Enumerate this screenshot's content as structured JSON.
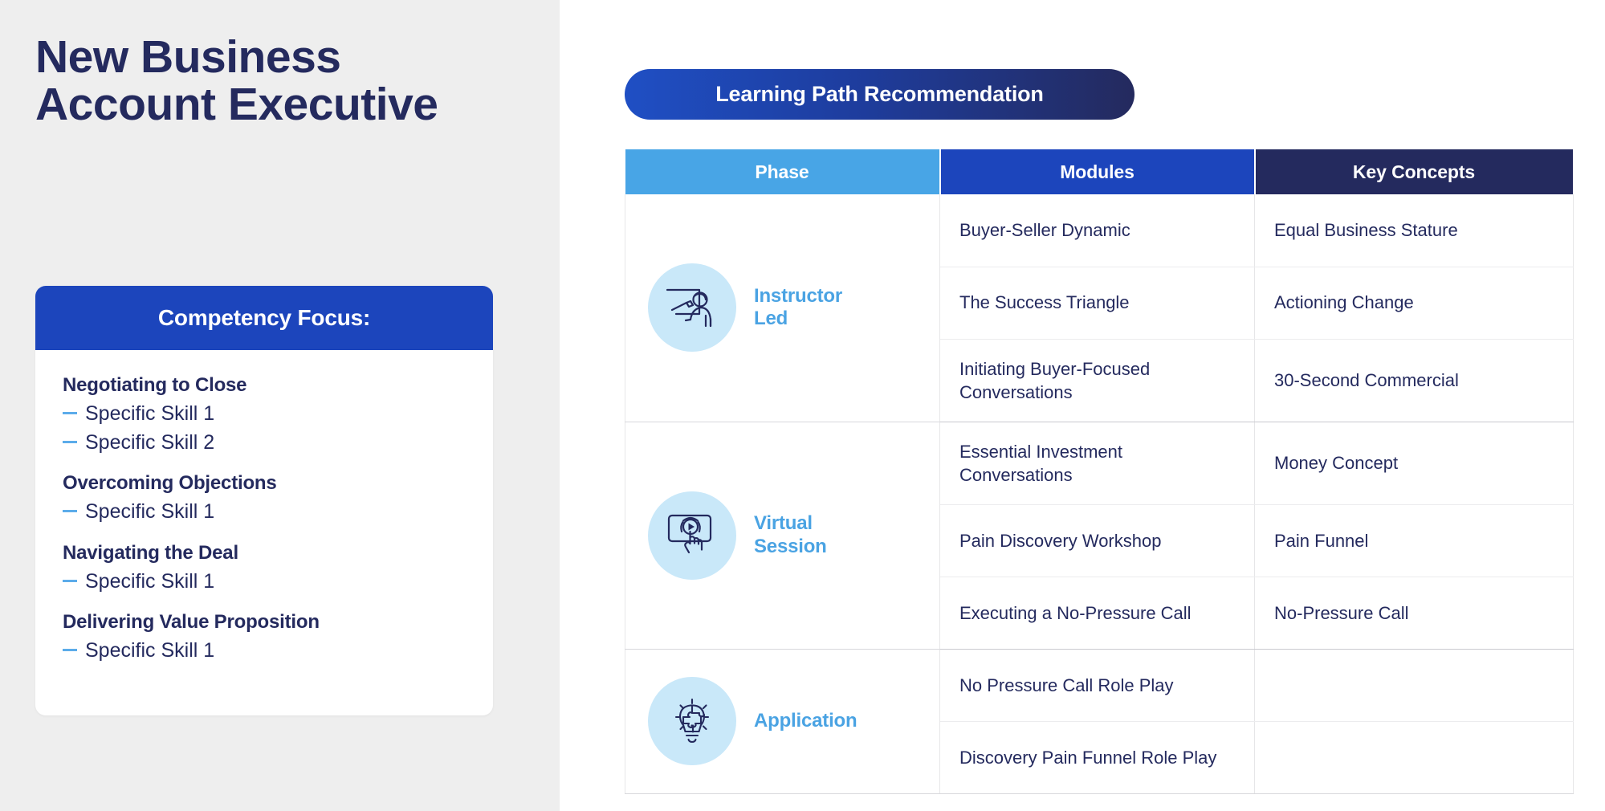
{
  "left": {
    "title": "New Business Account Executive",
    "card": {
      "header": "Competency Focus:",
      "groups": [
        {
          "title": "Negotiating to Close",
          "skills": [
            "Specific Skill 1",
            "Specific Skill 2"
          ]
        },
        {
          "title": "Overcoming Objections",
          "skills": [
            "Specific Skill 1"
          ]
        },
        {
          "title": "Navigating the Deal",
          "skills": [
            "Specific Skill 1"
          ]
        },
        {
          "title": "Delivering Value Proposition",
          "skills": [
            "Specific Skill 1"
          ]
        }
      ]
    }
  },
  "right": {
    "banner": "Learning Path Recommendation",
    "table": {
      "headers": {
        "phase": "Phase",
        "modules": "Modules",
        "keys": "Key Concepts"
      },
      "groups": [
        {
          "phase_label": "Instructor Led",
          "phase_icon": "whiteboard-instructor-icon",
          "rows": [
            {
              "module": "Buyer-Seller Dynamic",
              "key": "Equal Business Stature"
            },
            {
              "module": "The Success Triangle",
              "key": "Actioning Change"
            },
            {
              "module": "Initiating Buyer-Focused Conversations",
              "key": "30-Second Commercial"
            }
          ]
        },
        {
          "phase_label": "Virtual Session",
          "phase_icon": "video-play-touch-icon",
          "rows": [
            {
              "module": "Essential Investment Conversations",
              "key": "Money Concept"
            },
            {
              "module": "Pain Discovery Workshop",
              "key": "Pain Funnel"
            },
            {
              "module": "Executing a No-Pressure Call",
              "key": "No-Pressure Call"
            }
          ]
        },
        {
          "phase_label": "Application",
          "phase_icon": "puzzle-lightbulb-icon",
          "rows": [
            {
              "module": "No Pressure Call Role Play",
              "key": ""
            },
            {
              "module": "Discovery Pain Funnel Role Play",
              "key": ""
            }
          ]
        }
      ]
    }
  },
  "colors": {
    "navy": "#242a5e",
    "brand_blue": "#1c45bc",
    "light_blue": "#48a5e6",
    "icon_circle": "#c9e8f9",
    "dash": "#5cacea",
    "panel_bg": "#eeeeee"
  }
}
